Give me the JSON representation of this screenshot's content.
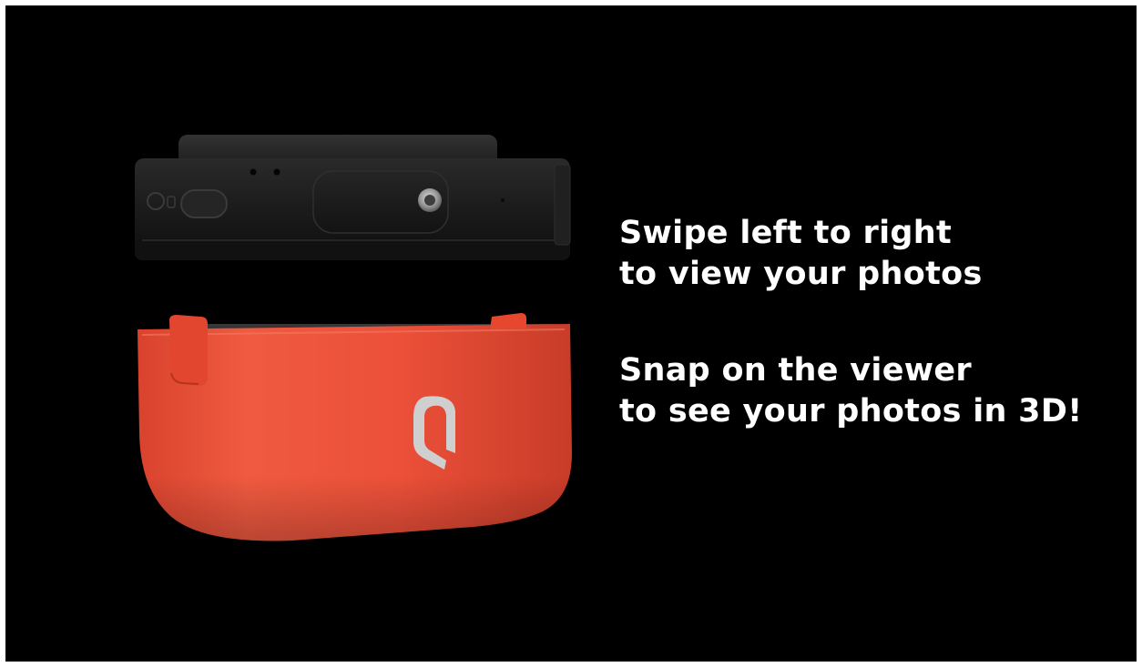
{
  "captions": [
    {
      "lines": [
        "Swipe left to right",
        "to view your photos"
      ]
    },
    {
      "lines": [
        "Snap on the viewer",
        "to see your photos in 3D!"
      ]
    }
  ],
  "product": {
    "camera_color": "#1a1a1a",
    "viewer_color": "#ec4f38",
    "logo_color": "#c9c9c9",
    "background_color": "#000000"
  }
}
